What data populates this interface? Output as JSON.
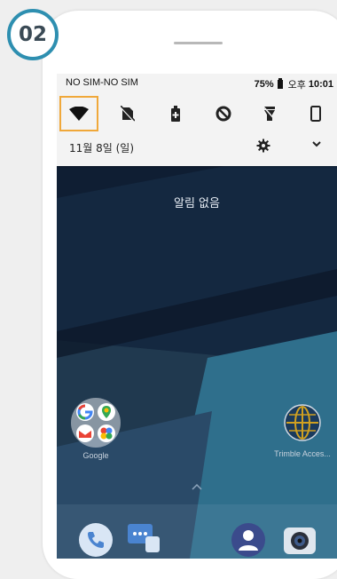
{
  "step_badge": "02",
  "status_bar": {
    "carrier": "NO SIM-NO SIM",
    "battery": "75%",
    "ampm": "오후",
    "time": "10:01"
  },
  "quick_tiles": [
    {
      "icon": "wifi-icon",
      "selected": true
    },
    {
      "icon": "no-sim-icon",
      "selected": false
    },
    {
      "icon": "battery-saver-icon",
      "selected": false
    },
    {
      "icon": "do-not-disturb-icon",
      "selected": false
    },
    {
      "icon": "flashlight-icon",
      "selected": false
    },
    {
      "icon": "screen-rotation-icon",
      "selected": false
    }
  ],
  "date": "11월 8일 (일)",
  "no_notifications": "알림 없음",
  "home": {
    "apps": [
      {
        "label": "Google",
        "icon": "google-folder-icon"
      },
      {
        "label": "Trimble Acces...",
        "icon": "globe-icon"
      }
    ],
    "dock": [
      "phone-icon",
      "messages-icon",
      "contacts-icon",
      "camera-icon"
    ]
  },
  "colors": {
    "accent_badge": "#2e8fb0",
    "tile_highlight": "#f0a83a",
    "wallpaper": "#0f1e33"
  }
}
